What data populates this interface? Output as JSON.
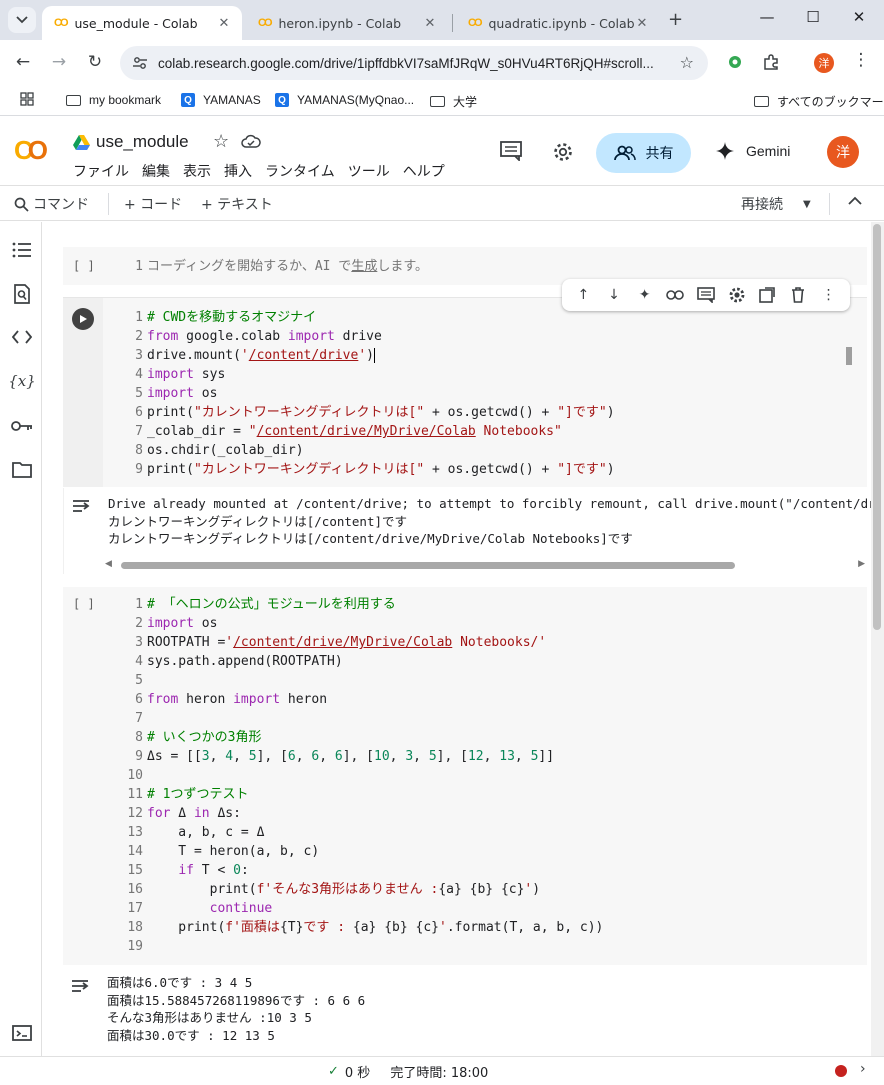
{
  "browser": {
    "tabs": [
      {
        "title": "use_module - Colab",
        "active": true
      },
      {
        "title": "heron.ipynb - Colab",
        "active": false
      },
      {
        "title": "quadratic.ipynb - Colab",
        "active": false
      }
    ],
    "url": "colab.research.google.com/drive/1ipffdbkVI7saMfJRqW_s0HVu4RT6RjQH#scroll...",
    "profile_initial": "洋",
    "bookmarks": {
      "b1": "my bookmark",
      "b2": "YAMANAS",
      "b3": "YAMANAS(MyQnao...",
      "b4": "大学",
      "all": "すべてのブックマーク"
    }
  },
  "colab": {
    "logo": "CO",
    "notebook_title": "use_module",
    "menu": [
      "ファイル",
      "編集",
      "表示",
      "挿入",
      "ランタイム",
      "ツール",
      "ヘルプ"
    ],
    "share_label": "共有",
    "gemini_label": "Gemini",
    "avatar_initial": "洋",
    "cmdbar": {
      "command": "コマンド",
      "code": "+ コード",
      "text": "+ テキスト",
      "reconnect": "再接続"
    }
  },
  "cells": {
    "empty_cell": {
      "bracket": "[ ]",
      "placeholder_num": "1",
      "placeholder_text": "コーディングを開始するか、AI で",
      "placeholder_link": "生成",
      "placeholder_tail": "します。"
    },
    "cell1_output": [
      "Drive already mounted at /content/drive; to attempt to forcibly remount, call drive.mount(\"/content/drive\", f",
      "カレントワーキングディレクトリは[/content]です",
      "カレントワーキングディレクトリは[/content/drive/MyDrive/Colab Notebooks]です"
    ],
    "cell2_bracket": "[ ]",
    "cell2_output": [
      "面積は6.0です : 3 4 5",
      "面積は15.588457268119896です : 6 6 6",
      "そんな3角形はありません :10 3 5",
      "面積は30.0です : 12 13 5"
    ]
  },
  "status": {
    "check": "✓",
    "duration": "0 秒",
    "completed": "完了時間: 18:00"
  },
  "colors": {
    "accent_share": "#c2e7ff",
    "avatar": "#e8581f",
    "keyword": "#9c27b0",
    "comment": "#008000",
    "string": "#a31515",
    "status_dot": "#c5221f"
  }
}
